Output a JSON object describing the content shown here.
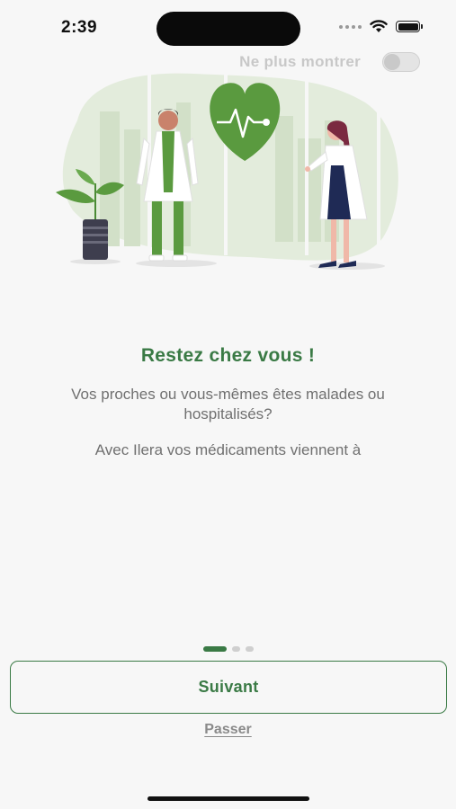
{
  "status_bar": {
    "time": "2:39"
  },
  "header": {
    "dont_show_label": "Ne plus montrer",
    "dont_show_enabled": false
  },
  "illustration": {
    "icon": "doctors-heart-illustration"
  },
  "content": {
    "title": "Restez chez vous !",
    "description": "Vos proches ou vous-mêmes êtes malades ou hospitalisés?",
    "description_2": "Avec Ilera vos médicaments viennent à"
  },
  "pager": {
    "total": 3,
    "active": 0
  },
  "actions": {
    "next_label": "Suivant",
    "skip_label": "Passer"
  },
  "colors": {
    "accent": "#3a7a45",
    "heart": "#5a9a3f",
    "muted_text": "#707070"
  }
}
